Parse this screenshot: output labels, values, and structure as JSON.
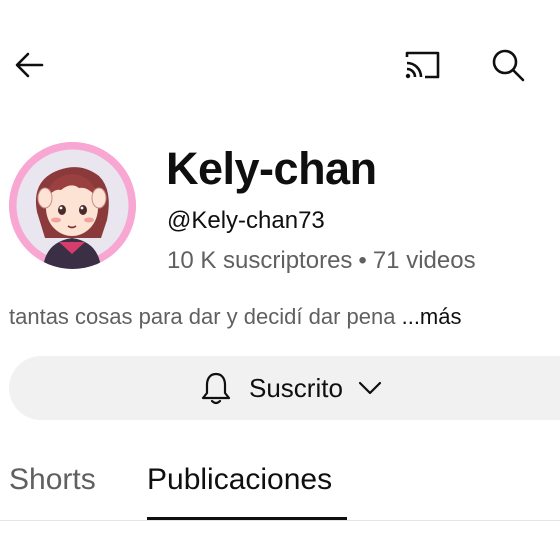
{
  "header": {
    "back_icon": "arrow-left-icon",
    "cast_icon": "cast-icon",
    "search_icon": "search-icon"
  },
  "channel": {
    "name": "Kely-chan",
    "handle": "@Kely-chan73",
    "subscribers": "10 K suscriptores",
    "separator": "•",
    "videos": "71 videos",
    "description": "tantas cosas para dar y decidí dar pena",
    "more_label": "...más",
    "avatar_ring_color": "#f7a7d2"
  },
  "subscribe": {
    "label": "Suscrito",
    "bell_icon": "bell-icon",
    "chevron_icon": "chevron-down-icon"
  },
  "tabs": [
    {
      "label": "Shorts",
      "selected": false
    },
    {
      "label": "Publicaciones",
      "selected": true
    }
  ]
}
